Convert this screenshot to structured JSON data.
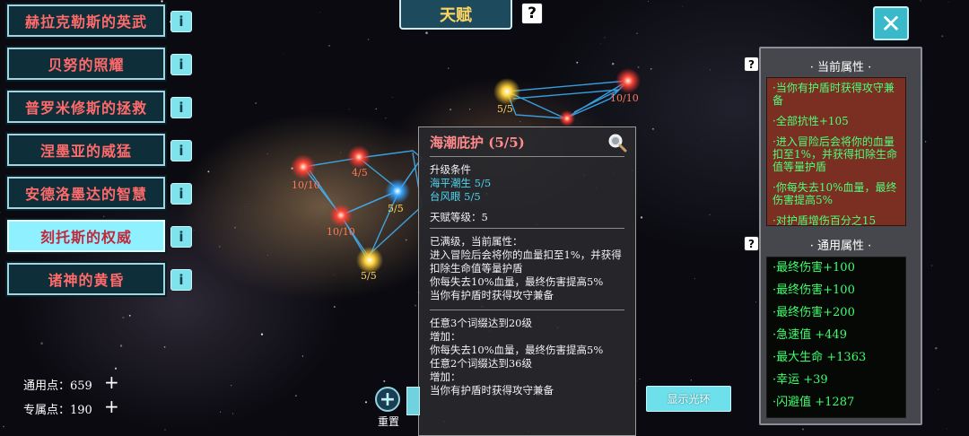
{
  "header": {
    "title": "天赋"
  },
  "talents": [
    {
      "label": "赫拉克勒斯的英武"
    },
    {
      "label": "贝努的照耀"
    },
    {
      "label": "普罗米修斯的拯救"
    },
    {
      "label": "涅墨亚的威猛"
    },
    {
      "label": "安德洛墨达的智慧"
    },
    {
      "label": "刻托斯的权威",
      "active": true
    },
    {
      "label": "诸神的黄昏"
    }
  ],
  "info_symbol": "i",
  "help_symbol": "?",
  "close_symbol": "✕",
  "nodes": [
    {
      "label": "10/10"
    },
    {
      "label": "4/5"
    },
    {
      "label": "5/5"
    },
    {
      "label": "10/10"
    },
    {
      "label": "5/5"
    },
    {
      "label": "5/5"
    },
    {
      "label": "10/10"
    }
  ],
  "tooltip": {
    "title": "海潮庇护 (5/5)",
    "req_label": "升级条件",
    "req_1": "海平潮生 5/5",
    "req_2": "台风眼 5/5",
    "level": "天赋等级：5",
    "maxed": "已满级，当前属性：",
    "effect_1": "进入冒险后会将你的血量扣至1%，并获得扣除生命值等量护盾",
    "effect_2": "你每失去10%血量，最终伤害提高5%",
    "effect_3": "当你有护盾时获得攻守兼备",
    "bonus_1_cond": "任意3个词缀达到20级",
    "bonus_1_add": "增加：",
    "bonus_1_eff": "你每失去10%血量，最终伤害提高5%",
    "bonus_2_cond": "任意2个词缀达到36级",
    "bonus_2_add": "增加：",
    "bonus_2_eff": "当你有护盾时获得攻守兼备"
  },
  "attributes": {
    "current_title": "· 当前属性 ·",
    "current": [
      "·当你有护盾时获得攻守兼备",
      "·全部抗性+105",
      "·进入冒险后会将你的血量扣至1%，并获得扣除生命值等量护盾",
      "·你每失去10%血量，最终伤害提高5%",
      "·对护盾增伤百分之15"
    ],
    "general_title": "· 通用属性 ·",
    "general": [
      "·最终伤害+100",
      "·最终伤害+100",
      "·最终伤害+200",
      "·急速值 +449",
      "·最大生命 +1363",
      "·幸运 +39",
      "·闪避值 +1287"
    ]
  },
  "points": {
    "general_label": "通用点：659",
    "exclusive_label": "专属点：190",
    "plus": "+"
  },
  "reset": {
    "icon": "+",
    "label": "重置"
  },
  "halo_button": "显示光环"
}
